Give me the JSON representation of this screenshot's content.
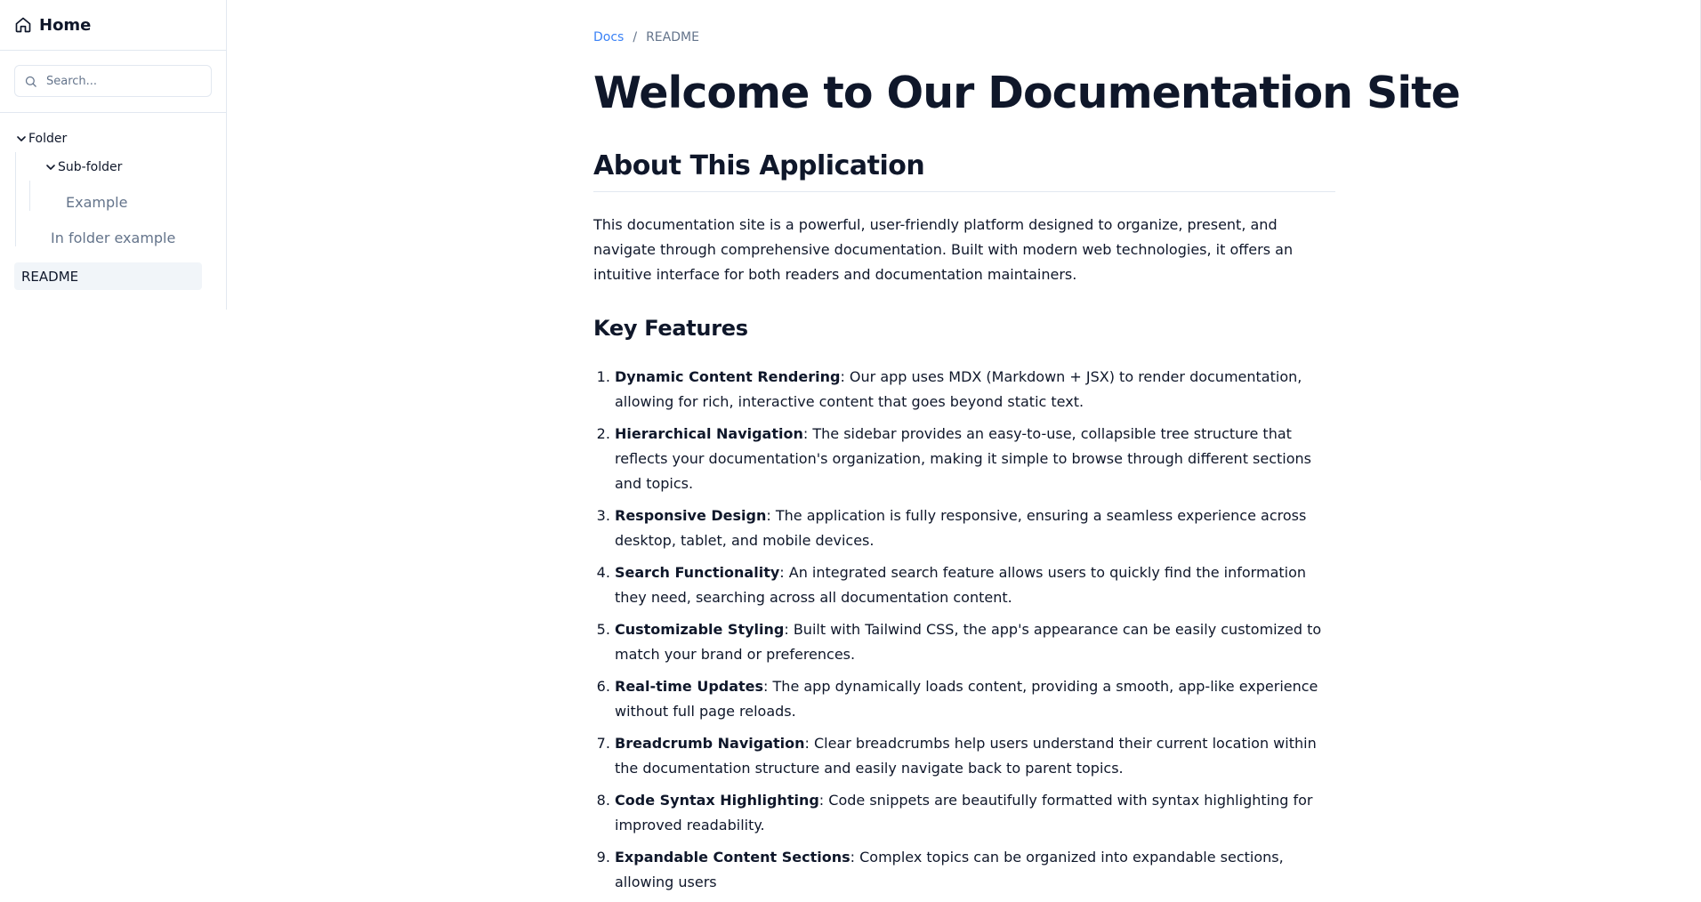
{
  "sidebar": {
    "home_label": "Home",
    "search_placeholder": "Search...",
    "tree": {
      "folder_label": "Folder",
      "subfolder_label": "Sub-folder",
      "example_label": "Example",
      "in_folder_example_label": "In folder example",
      "readme_label": "README"
    }
  },
  "breadcrumb": {
    "root": "Docs",
    "separator": "/",
    "current": "README"
  },
  "content": {
    "title": "Welcome to Our Documentation Site",
    "section_title": "About This Application",
    "intro": "This documentation site is a powerful, user-friendly platform designed to organize, present, and navigate through comprehensive documentation. Built with modern web technologies, it offers an intuitive interface for both readers and documentation maintainers.",
    "features_title": "Key Features",
    "features": [
      {
        "name": "Dynamic Content Rendering",
        "desc": ": Our app uses MDX (Markdown + JSX) to render documentation, allowing for rich, interactive content that goes beyond static text."
      },
      {
        "name": "Hierarchical Navigation",
        "desc": ": The sidebar provides an easy-to-use, collapsible tree structure that reflects your documentation's organization, making it simple to browse through different sections and topics."
      },
      {
        "name": "Responsive Design",
        "desc": ": The application is fully responsive, ensuring a seamless experience across desktop, tablet, and mobile devices."
      },
      {
        "name": "Search Functionality",
        "desc": ": An integrated search feature allows users to quickly find the information they need, searching across all documentation content."
      },
      {
        "name": "Customizable Styling",
        "desc": ": Built with Tailwind CSS, the app's appearance can be easily customized to match your brand or preferences."
      },
      {
        "name": "Real-time Updates",
        "desc": ": The app dynamically loads content, providing a smooth, app-like experience without full page reloads."
      },
      {
        "name": "Breadcrumb Navigation",
        "desc": ": Clear breadcrumbs help users understand their current location within the documentation structure and easily navigate back to parent topics."
      },
      {
        "name": "Code Syntax Highlighting",
        "desc": ": Code snippets are beautifully formatted with syntax highlighting for improved readability."
      },
      {
        "name": "Expandable Content Sections",
        "desc": ": Complex topics can be organized into expandable sections, allowing users"
      }
    ]
  },
  "colors": {
    "accent_link": "#3b82f6",
    "muted_text": "#64748b",
    "active_bg": "#f1f5f9",
    "border": "#e2e8f0"
  },
  "icons": {
    "home": "home-icon",
    "search": "search-icon",
    "chevron": "chevron-down-icon"
  }
}
